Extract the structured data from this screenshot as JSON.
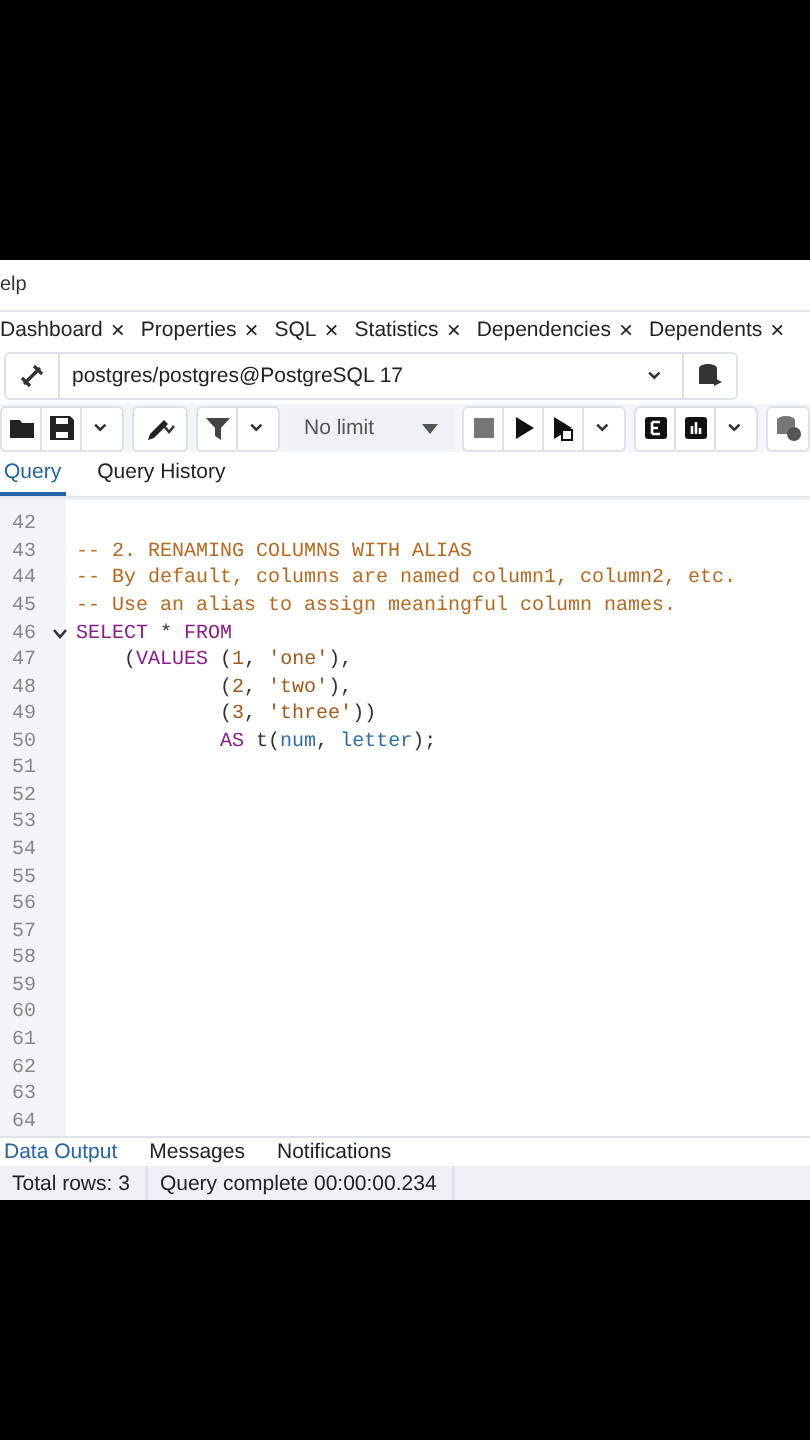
{
  "menu": {
    "label": "elp"
  },
  "panel_tabs": [
    {
      "label": "Dashboard",
      "close": "×"
    },
    {
      "label": "Properties",
      "close": "×"
    },
    {
      "label": "SQL",
      "close": "×"
    },
    {
      "label": "Statistics",
      "close": "×"
    },
    {
      "label": "Dependencies",
      "close": "×"
    },
    {
      "label": "Dependents",
      "close": "×"
    }
  ],
  "connection": {
    "value": "postgres/postgres@PostgreSQL 17"
  },
  "toolbar": {
    "limit": "No limit"
  },
  "query_tabs": [
    {
      "label": "Query",
      "selected": true
    },
    {
      "label": "Query History",
      "selected": false
    }
  ],
  "editor": {
    "lines": [
      {
        "number": "42",
        "fold": false
      },
      {
        "number": "43",
        "fold": false,
        "tokens": [
          {
            "text": "-- 2. RENAMING COLUMNS WITH ALIAS",
            "kind": "comment"
          }
        ]
      },
      {
        "number": "44",
        "fold": false,
        "tokens": [
          {
            "text": "-- By default, columns are named column1, column2, etc.",
            "kind": "comment"
          }
        ]
      },
      {
        "number": "45",
        "fold": false,
        "tokens": [
          {
            "text": "-- Use an alias to assign meaningful column names.",
            "kind": "comment"
          }
        ]
      },
      {
        "number": "46",
        "fold": true,
        "tokens": [
          {
            "text": "SELECT",
            "kind": "keyword"
          },
          {
            "text": " * ",
            "kind": "plain"
          },
          {
            "text": "FROM",
            "kind": "keyword"
          }
        ]
      },
      {
        "number": "47",
        "fold": false,
        "tokens": [
          {
            "text": "    (",
            "kind": "plain"
          },
          {
            "text": "VALUES",
            "kind": "keyword"
          },
          {
            "text": " (",
            "kind": "plain"
          },
          {
            "text": "1",
            "kind": "number"
          },
          {
            "text": ", ",
            "kind": "plain"
          },
          {
            "text": "'one'",
            "kind": "string"
          },
          {
            "text": "),",
            "kind": "plain"
          }
        ]
      },
      {
        "number": "48",
        "fold": false,
        "tokens": [
          {
            "text": "            (",
            "kind": "plain"
          },
          {
            "text": "2",
            "kind": "number"
          },
          {
            "text": ", ",
            "kind": "plain"
          },
          {
            "text": "'two'",
            "kind": "string"
          },
          {
            "text": "),",
            "kind": "plain"
          }
        ]
      },
      {
        "number": "49",
        "fold": false,
        "tokens": [
          {
            "text": "            (",
            "kind": "plain"
          },
          {
            "text": "3",
            "kind": "number"
          },
          {
            "text": ", ",
            "kind": "plain"
          },
          {
            "text": "'three'",
            "kind": "string"
          },
          {
            "text": "))",
            "kind": "plain"
          }
        ]
      },
      {
        "number": "50",
        "fold": false,
        "tokens": [
          {
            "text": "            AS",
            "kind": "keyword"
          },
          {
            "text": " t(",
            "kind": "plain"
          },
          {
            "text": "num",
            "kind": "ident"
          },
          {
            "text": ", ",
            "kind": "plain"
          },
          {
            "text": "letter",
            "kind": "ident"
          },
          {
            "text": ");",
            "kind": "plain"
          }
        ]
      },
      {
        "number": "51",
        "fold": false
      },
      {
        "number": "52",
        "fold": false
      },
      {
        "number": "53",
        "fold": false
      },
      {
        "number": "54",
        "fold": false
      },
      {
        "number": "55",
        "fold": false
      },
      {
        "number": "56",
        "fold": false
      },
      {
        "number": "57",
        "fold": false
      },
      {
        "number": "58",
        "fold": false
      },
      {
        "number": "59",
        "fold": false
      },
      {
        "number": "60",
        "fold": false
      },
      {
        "number": "61",
        "fold": false
      },
      {
        "number": "62",
        "fold": false
      },
      {
        "number": "63",
        "fold": false
      },
      {
        "number": "64",
        "fold": false
      }
    ]
  },
  "output_tabs": [
    {
      "label": "Data Output",
      "selected": true
    },
    {
      "label": "Messages",
      "selected": false
    },
    {
      "label": "Notifications",
      "selected": false
    }
  ],
  "status_bar": {
    "rows": "Total rows: 3",
    "message": "Query complete 00:00:00.234"
  }
}
